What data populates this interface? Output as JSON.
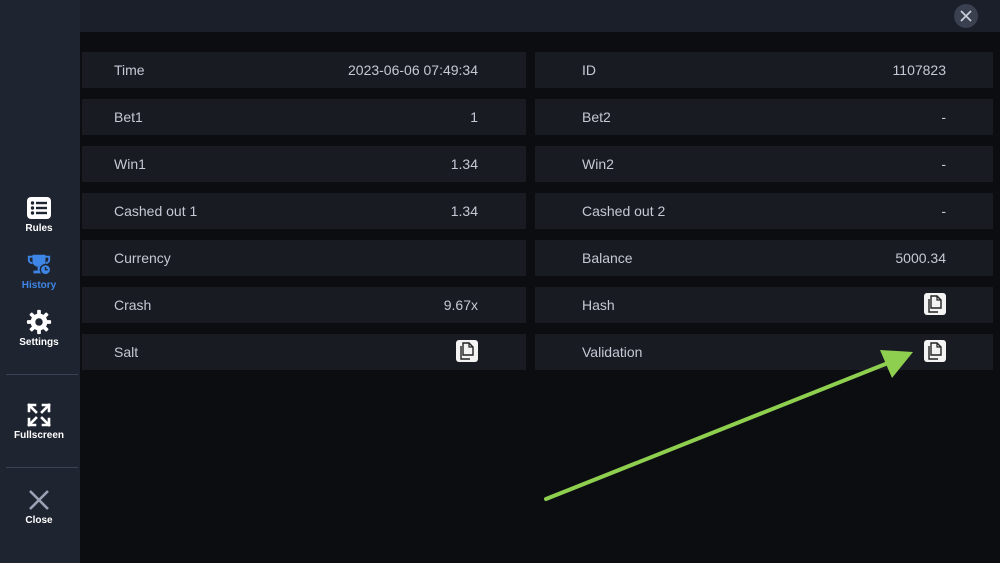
{
  "sidebar": {
    "rules_label": "Rules",
    "history_label": "History",
    "settings_label": "Settings",
    "fullscreen_label": "Fullscreen",
    "close_label": "Close",
    "active_color": "#3e86e6"
  },
  "details": {
    "time_label": "Time",
    "time_value": "2023-06-06 07:49:34",
    "id_label": "ID",
    "id_value": "1107823",
    "bet1_label": "Bet1",
    "bet1_value": "1",
    "bet2_label": "Bet2",
    "bet2_value": "-",
    "win1_label": "Win1",
    "win1_value": "1.34",
    "win2_label": "Win2",
    "win2_value": "-",
    "cashed1_label": "Cashed out 1",
    "cashed1_value": "1.34",
    "cashed2_label": "Cashed out 2",
    "cashed2_value": "-",
    "currency_label": "Currency",
    "currency_value": "",
    "balance_label": "Balance",
    "balance_value": "5000.34",
    "crash_label": "Crash",
    "crash_value": "9.67x",
    "hash_label": "Hash",
    "salt_label": "Salt",
    "validation_label": "Validation"
  },
  "annotation": {
    "arrow_color": "#8fcf4f"
  }
}
